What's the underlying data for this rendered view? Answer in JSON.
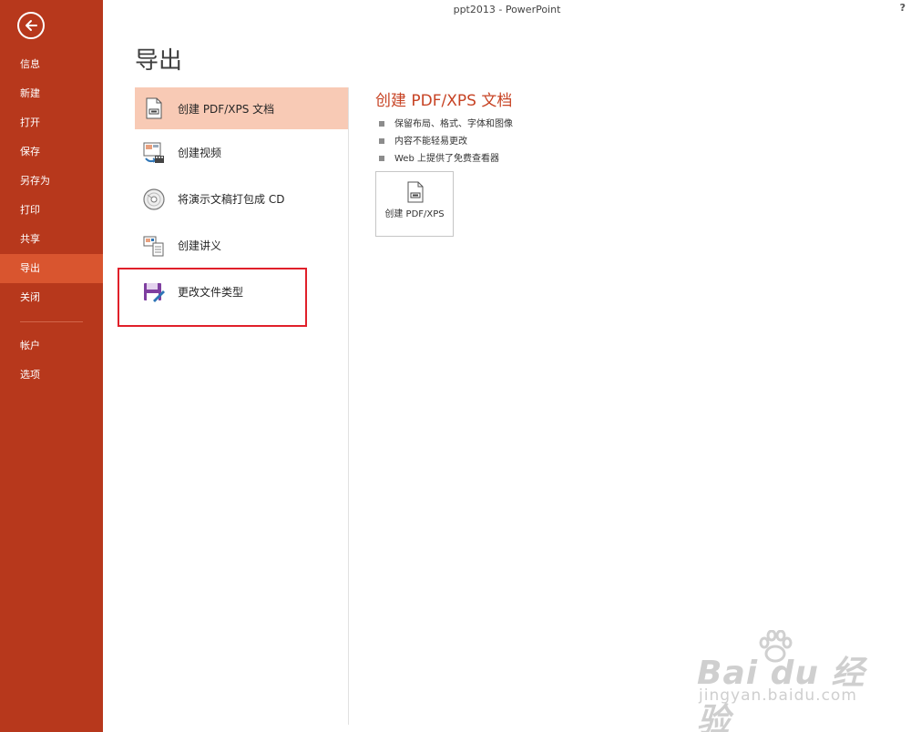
{
  "window": {
    "title": "ppt2013 - PowerPoint",
    "help": "?"
  },
  "sidebar": {
    "items": [
      {
        "label": "信息",
        "active": false
      },
      {
        "label": "新建",
        "active": false
      },
      {
        "label": "打开",
        "active": false
      },
      {
        "label": "保存",
        "active": false
      },
      {
        "label": "另存为",
        "active": false
      },
      {
        "label": "打印",
        "active": false
      },
      {
        "label": "共享",
        "active": false
      },
      {
        "label": "导出",
        "active": true
      },
      {
        "label": "关闭",
        "active": false
      }
    ],
    "bottom_items": [
      {
        "label": "帐户"
      },
      {
        "label": "选项"
      }
    ]
  },
  "main": {
    "title": "导出",
    "options": [
      {
        "label": "创建 PDF/XPS 文档",
        "icon": "pdf-document-icon",
        "active": true
      },
      {
        "label": "创建视频",
        "icon": "video-icon",
        "active": false
      },
      {
        "label": "将演示文稿打包成 CD",
        "icon": "cd-icon",
        "active": false
      },
      {
        "label": "创建讲义",
        "icon": "handout-icon",
        "active": false
      },
      {
        "label": "更改文件类型",
        "icon": "save-as-type-icon",
        "active": false
      }
    ]
  },
  "detail": {
    "title": "创建 PDF/XPS 文档",
    "bullets": [
      "保留布局、格式、字体和图像",
      "内容不能轻易更改",
      "Web 上提供了免费查看器"
    ],
    "button_label": "创建 PDF/XPS"
  },
  "watermark": {
    "main": "Bai du 经验",
    "sub": "jingyan.baidu.com"
  },
  "colors": {
    "sidebar": "#b7381c",
    "sidebar_active": "#d9552f",
    "option_active": "#f8cab5",
    "accent_text": "#c74324",
    "highlight_box": "#e0202a"
  }
}
